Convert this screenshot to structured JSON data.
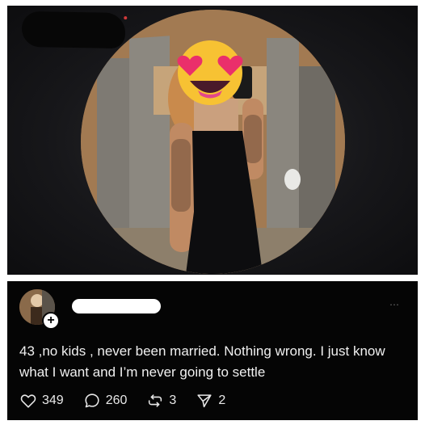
{
  "profile": {
    "image_description_icon": "profile-photo"
  },
  "post": {
    "more_icon": "⋯",
    "text": "43 ,no kids , never been married. Nothing wrong. I just know what I want and I’m  never going to settle",
    "actions": {
      "likes": "349",
      "replies": "260",
      "reposts": "3",
      "shares": "2"
    }
  }
}
